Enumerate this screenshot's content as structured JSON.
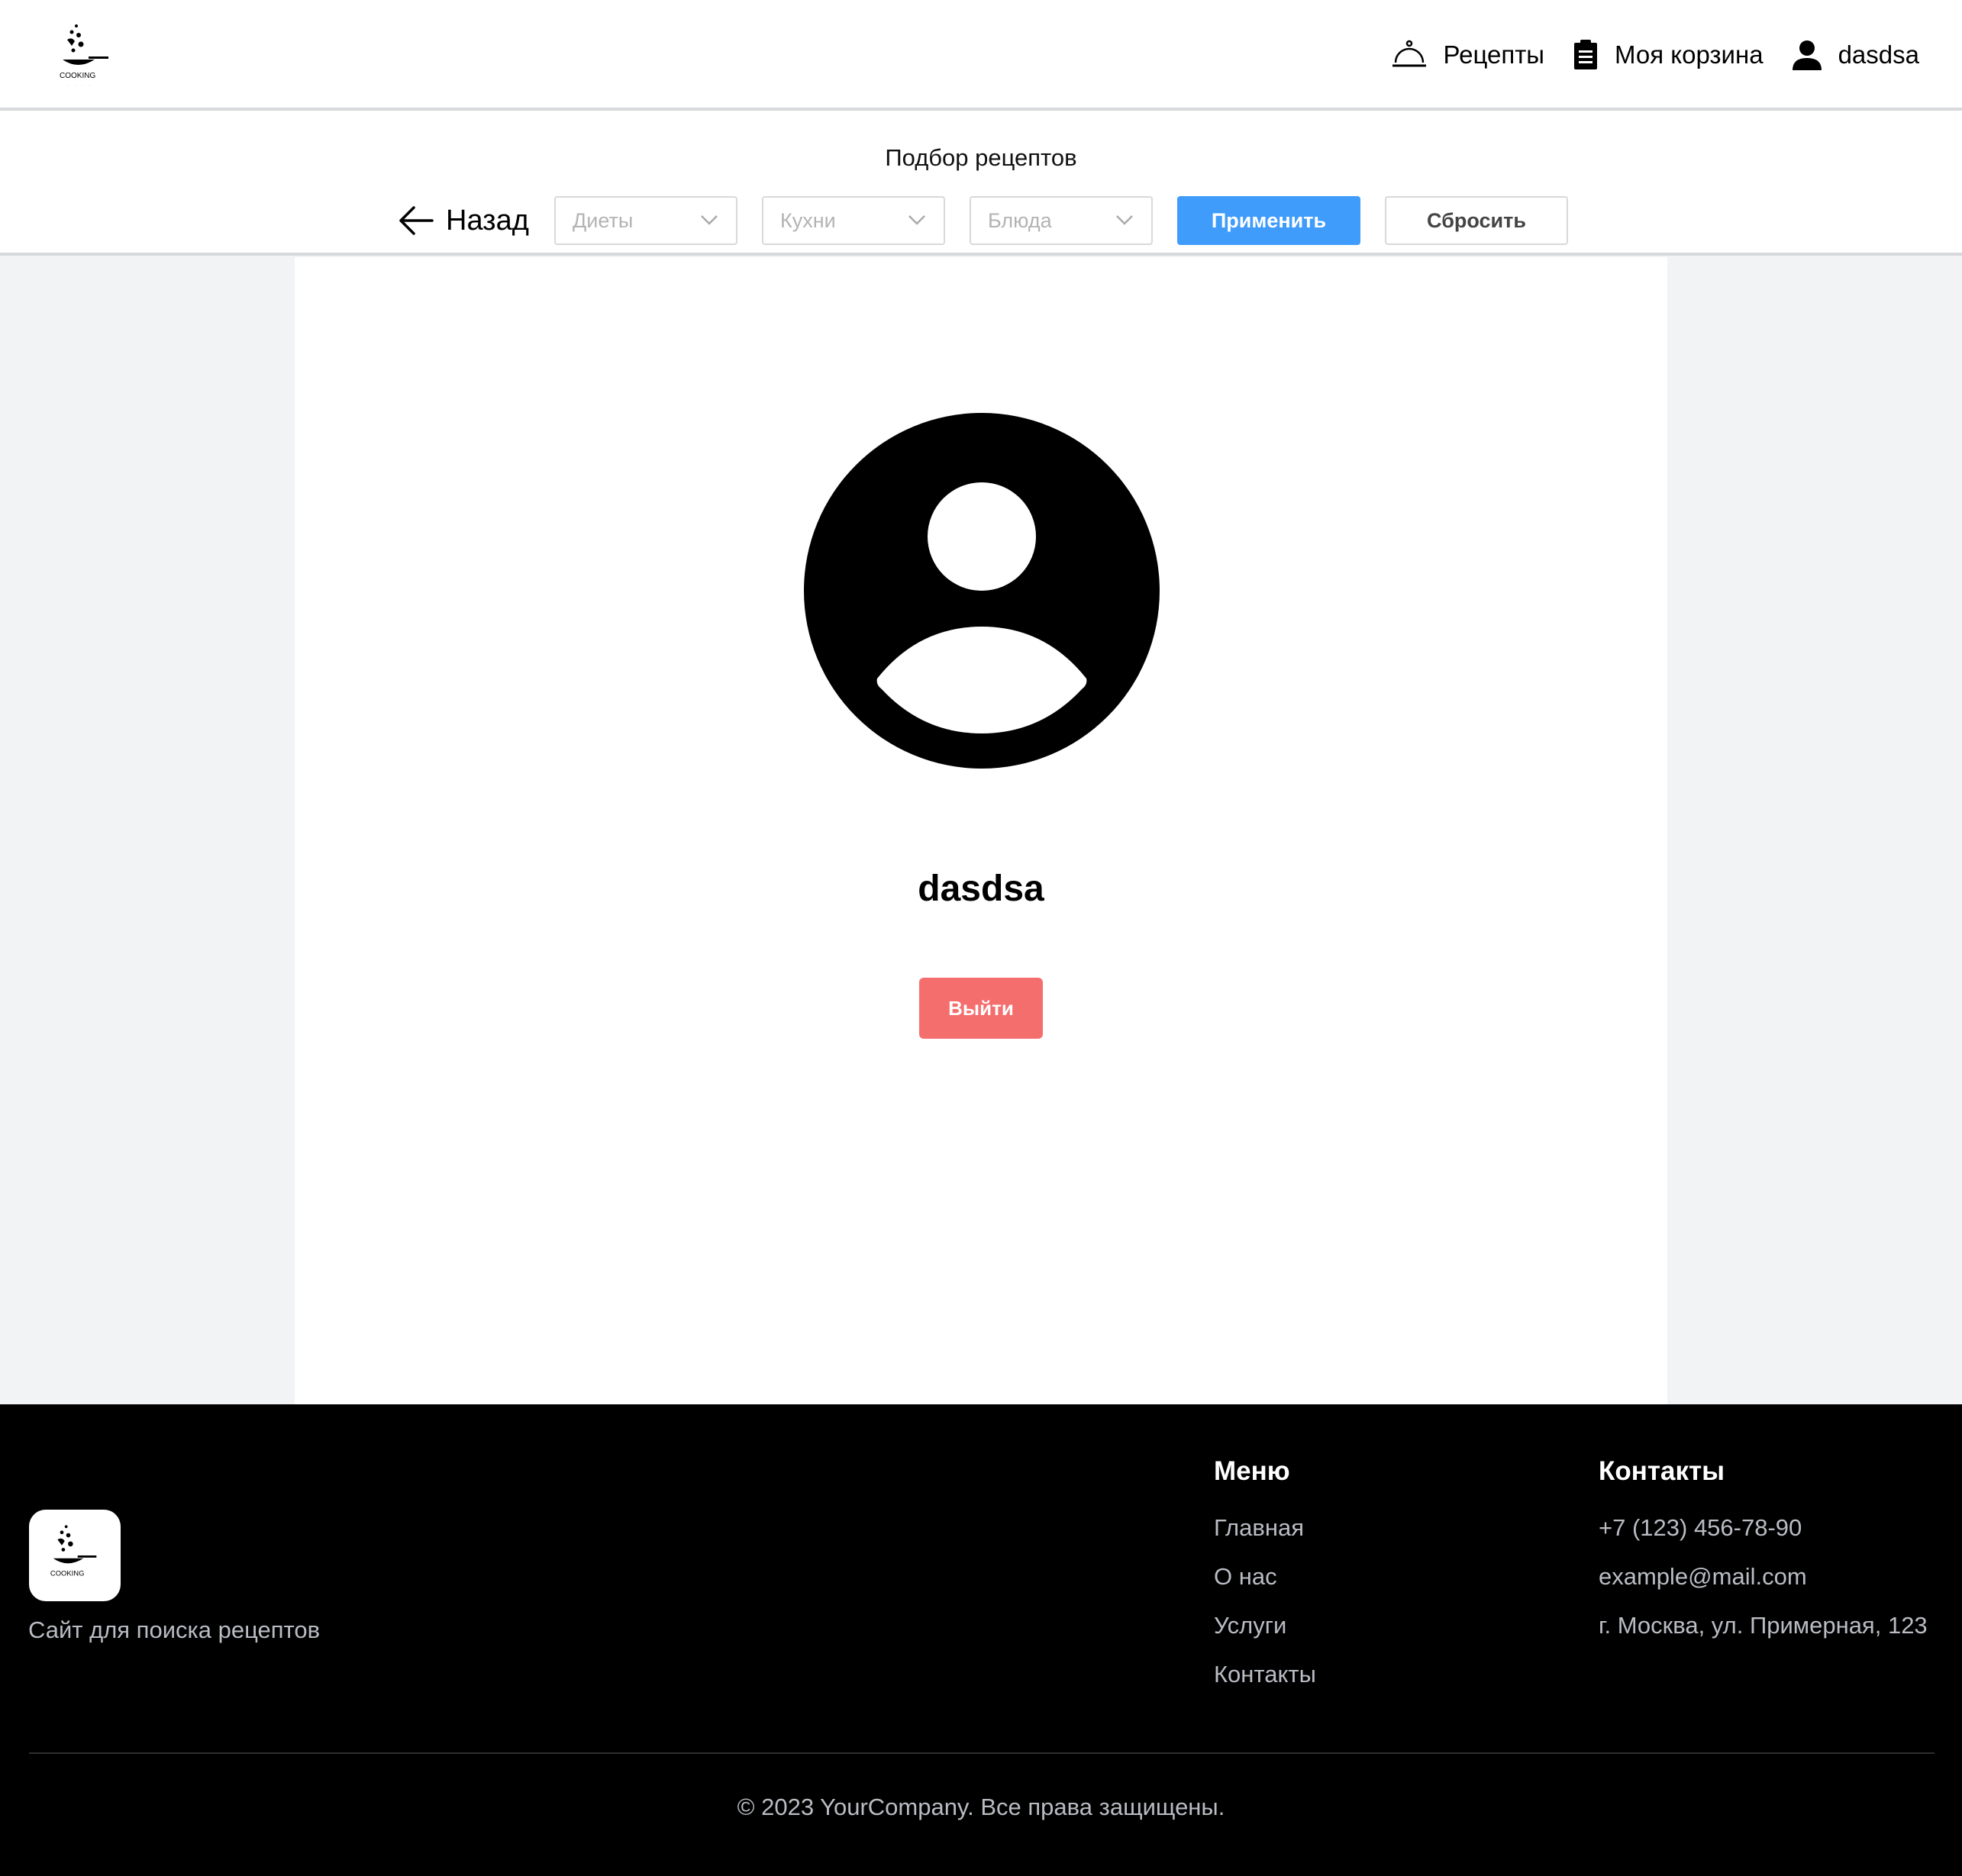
{
  "header": {
    "logo_text": "COOKING",
    "nav": [
      {
        "label": "Рецепты",
        "icon": "cloche-icon"
      },
      {
        "label": "Моя корзина",
        "icon": "clipboard-icon"
      },
      {
        "label": "dasdsa",
        "icon": "user-icon"
      }
    ]
  },
  "filters": {
    "title": "Подбор рецептов",
    "back_label": "Назад",
    "selects": [
      {
        "placeholder": "Диеты"
      },
      {
        "placeholder": "Кухни"
      },
      {
        "placeholder": "Блюда"
      }
    ],
    "apply_label": "Применить",
    "reset_label": "Сбросить"
  },
  "profile": {
    "username": "dasdsa",
    "logout_label": "Выйти",
    "avatar_icon": "user-circle-icon"
  },
  "footer": {
    "tagline": "Сайт для поиска рецептов",
    "menu": {
      "title": "Меню",
      "links": [
        "Главная",
        "О нас",
        "Услуги",
        "Контакты"
      ]
    },
    "contacts": {
      "title": "Контакты",
      "items": [
        "+7 (123) 456-78-90",
        "example@mail.com",
        "г. Москва, ул. Примерная, 123"
      ]
    },
    "copyright": "© 2023 YourCompany. Все права защищены."
  },
  "colors": {
    "accent": "#3f9cfb",
    "danger": "#f56e6e",
    "footer_bg": "#000000",
    "page_bg": "#f2f3f5"
  }
}
